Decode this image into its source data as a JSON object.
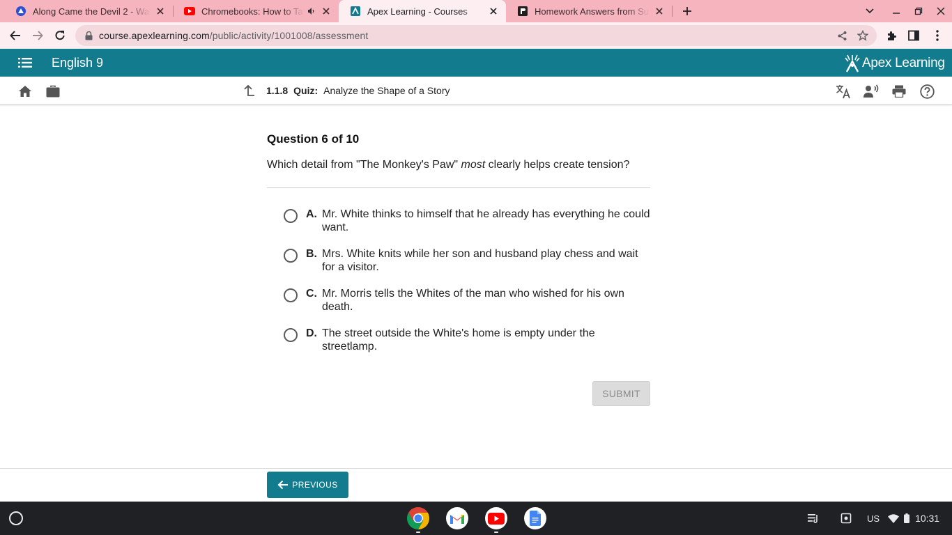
{
  "browser": {
    "tabs": [
      {
        "title": "Along Came the Devil 2 - Watch",
        "active": false
      },
      {
        "title": "Chromebooks: How to Take",
        "active": false
      },
      {
        "title": "Apex Learning - Courses",
        "active": true
      },
      {
        "title": "Homework Answers from Subjec",
        "active": false
      }
    ],
    "url_host": "course.apexlearning.com",
    "url_path": "/public/activity/1001008/assessment"
  },
  "app": {
    "course_title": "English 9",
    "logo_text": "Apex Learning",
    "brand_color": "#127c8e"
  },
  "activity": {
    "number": "1.1.8",
    "kind": "Quiz:",
    "name": "Analyze the Shape of a Story"
  },
  "question": {
    "header": "Question 6 of 10",
    "text_before": "Which detail from \"The Monkey's Paw\" ",
    "text_emphasis": "most",
    "text_after": " clearly helps create tension?",
    "options": [
      {
        "letter": "A.",
        "text": "Mr. White thinks to himself that he already has everything he could want."
      },
      {
        "letter": "B.",
        "text": "Mrs. White knits while her son and husband play chess and wait for a visitor."
      },
      {
        "letter": "C.",
        "text": "Mr. Morris tells the Whites of the man who wished for his own death."
      },
      {
        "letter": "D.",
        "text": "The street outside the White's home is empty under the streetlamp."
      }
    ],
    "submit_label": "SUBMIT"
  },
  "footer": {
    "previous_label": "PREVIOUS"
  },
  "system": {
    "locale": "US",
    "time": "10:31"
  }
}
